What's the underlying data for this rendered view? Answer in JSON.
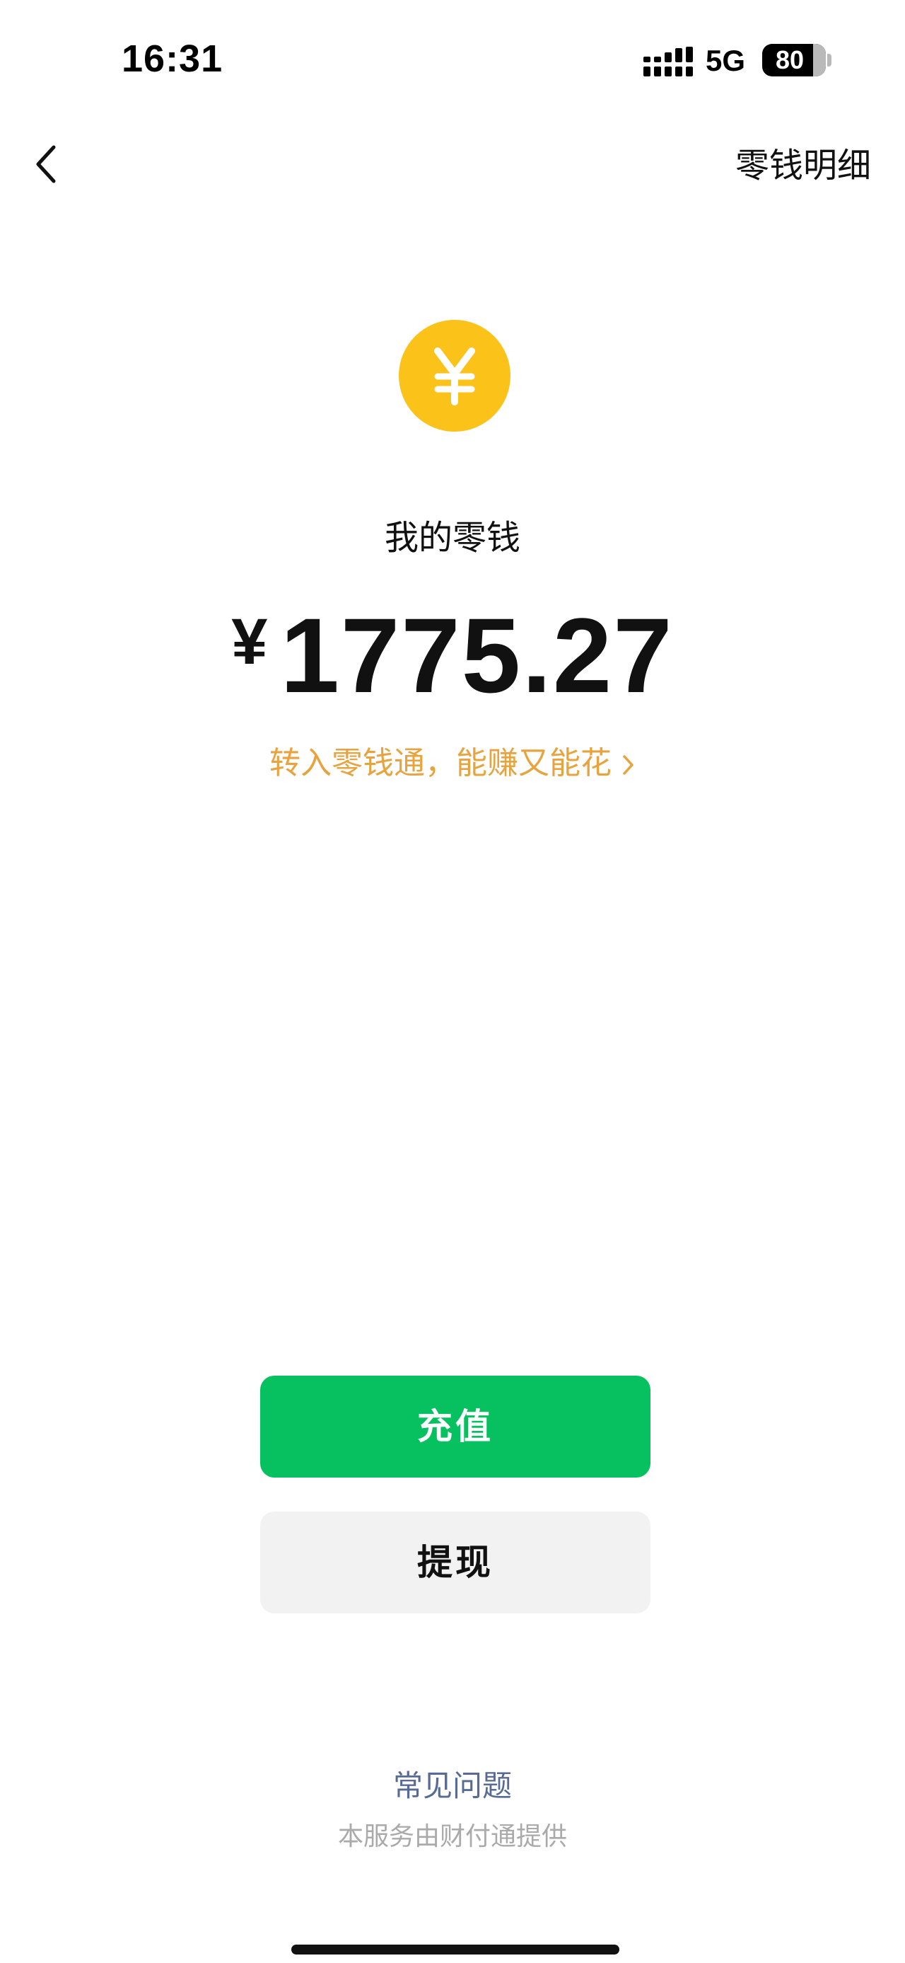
{
  "status_bar": {
    "time": "16:31",
    "network": "5G",
    "battery": "80"
  },
  "nav": {
    "right_link": "零钱明细"
  },
  "wallet": {
    "coin_icon": "yuan-coin-icon",
    "label": "我的零钱",
    "currency": "¥",
    "amount": "1775.27",
    "promo": "转入零钱通，能赚又能花"
  },
  "actions": {
    "topup": "充值",
    "withdraw": "提现"
  },
  "footer": {
    "faq": "常见问题",
    "provider": "本服务由财付通提供"
  },
  "colors": {
    "coin": "#fbc21a",
    "primary": "#07c160",
    "promo": "#e8a33e",
    "link": "#576b95"
  }
}
